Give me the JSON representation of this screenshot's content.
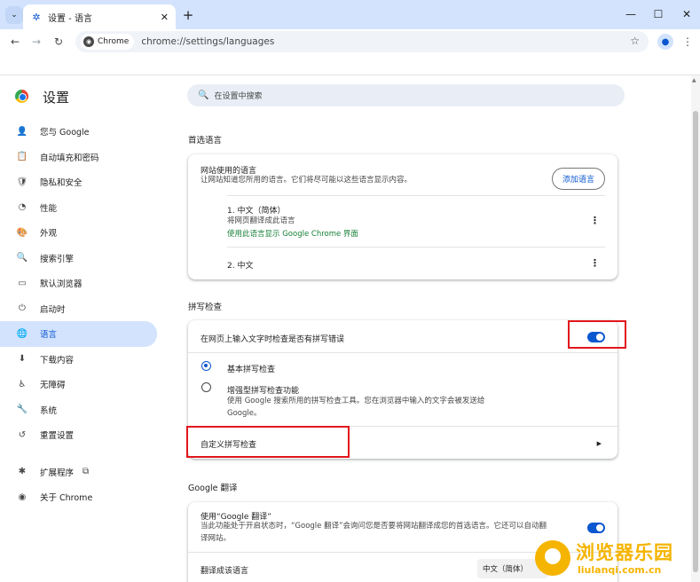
{
  "browser": {
    "tab_title": "设置 - 语言",
    "new_tab": "+",
    "window_controls": {
      "minimize": "—",
      "maximize": "☐",
      "close": "✕"
    },
    "site_chip": "Chrome",
    "url": "chrome://settings/languages"
  },
  "header": {
    "title": "设置",
    "search_placeholder": "在设置中搜索"
  },
  "sidebar": {
    "items": [
      {
        "label": "您与 Google",
        "icon": "person-icon",
        "glyph": "👤"
      },
      {
        "label": "自动填充和密码",
        "icon": "clipboard-icon",
        "glyph": "📋"
      },
      {
        "label": "隐私和安全",
        "icon": "shield-icon",
        "glyph": "🛡"
      },
      {
        "label": "性能",
        "icon": "speedometer-icon",
        "glyph": "◔"
      },
      {
        "label": "外观",
        "icon": "palette-icon",
        "glyph": "🎨"
      },
      {
        "label": "搜索引擎",
        "icon": "search-icon",
        "glyph": "🔍"
      },
      {
        "label": "默认浏览器",
        "icon": "browser-icon",
        "glyph": "▭"
      },
      {
        "label": "启动时",
        "icon": "power-icon",
        "glyph": "⏻"
      },
      {
        "label": "语言",
        "icon": "globe-icon",
        "glyph": "🌐",
        "active": true
      },
      {
        "label": "下载内容",
        "icon": "download-icon",
        "glyph": "⬇"
      },
      {
        "label": "无障碍",
        "icon": "accessibility-icon",
        "glyph": "♿"
      },
      {
        "label": "系统",
        "icon": "wrench-icon",
        "glyph": "🔧"
      },
      {
        "label": "重置设置",
        "icon": "reset-icon",
        "glyph": "↺"
      }
    ],
    "extensions": {
      "label": "扩展程序",
      "icon": "puzzle-icon",
      "glyph": "✱"
    },
    "about": {
      "label": "关于 Chrome",
      "icon": "chrome-icon",
      "glyph": "◉"
    }
  },
  "preferred_languages": {
    "section_title": "首选语言",
    "card_title": "网站使用的语言",
    "card_desc": "让网站知道您所用的语言。它们将尽可能以这些语言显示内容。",
    "add_button": "添加语言",
    "languages": [
      {
        "name": "1. 中文（简体）",
        "sub": "将网页翻译成此语言",
        "link": "使用此语言显示 Google Chrome 界面"
      },
      {
        "name": "2. 中文"
      }
    ]
  },
  "spell_check": {
    "section_title": "拼写检查",
    "toggle_label": "在网页上输入文字时检查是否有拼写错误",
    "toggle_on": true,
    "basic_label": "基本拼写检查",
    "enhanced_label": "增强型拼写检查功能",
    "enhanced_desc_1": "使用 Google 搜索所用的拼写检查工具。您在浏览器中输入的文字会被发送给",
    "enhanced_desc_2": "Google。",
    "custom_label": "自定义拼写检查"
  },
  "translate": {
    "section_title": "Google 翻译",
    "use_label": "使用“Google 翻译”",
    "use_desc_1": "当此功能处于开启状态时，“Google 翻译”会询问您是否要将网站翻译成您的首选语言。它还可以自动翻",
    "use_desc_2": "译网站。",
    "toggle_on": true,
    "target_label": "翻译成该语言",
    "target_value": "中文（简体）"
  },
  "watermark": {
    "text": "浏览器乐园",
    "url": "liulanqi.com.cn"
  },
  "colors": {
    "accent": "#0b57d0",
    "highlight": "#e3161c",
    "link_green": "#188038",
    "watermark": "#f5b400"
  }
}
